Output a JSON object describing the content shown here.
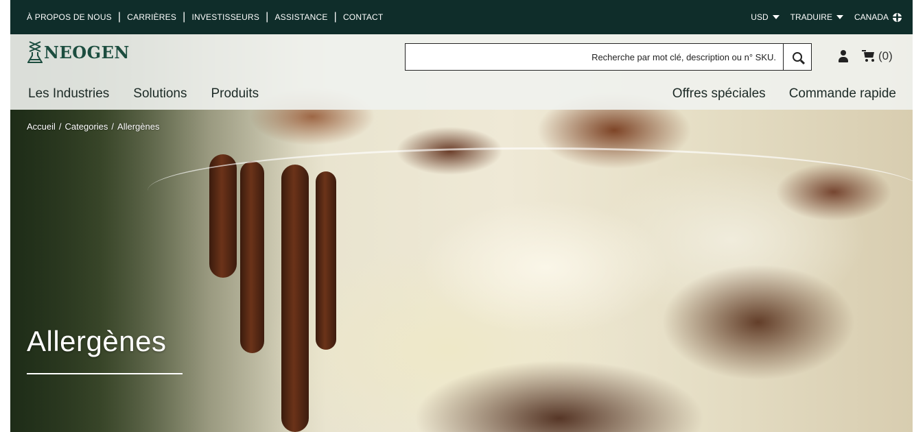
{
  "utility_bar": {
    "links": [
      "À PROPOS DE NOUS",
      "CARRIÈRES",
      "INVESTISSEURS",
      "ASSISTANCE",
      "CONTACT"
    ],
    "currency": "USD",
    "translate": "TRADUIRE",
    "region": "CANADA"
  },
  "header": {
    "logo_text": "NEOGEN",
    "search": {
      "placeholder": "Recherche par mot clé, description ou n° SKU."
    },
    "cart_count": "(0)"
  },
  "nav": {
    "left": [
      "Les Industries",
      "Solutions",
      "Produits"
    ],
    "right": [
      "Offres spéciales",
      "Commande rapide"
    ]
  },
  "breadcrumb": [
    "Accueil",
    "/",
    "Categories",
    "/",
    "Allergènes"
  ],
  "hero": {
    "title": "Allergènes"
  },
  "colors": {
    "utility_bg": "#0f2d2a",
    "logo": "#1c4d3f"
  }
}
